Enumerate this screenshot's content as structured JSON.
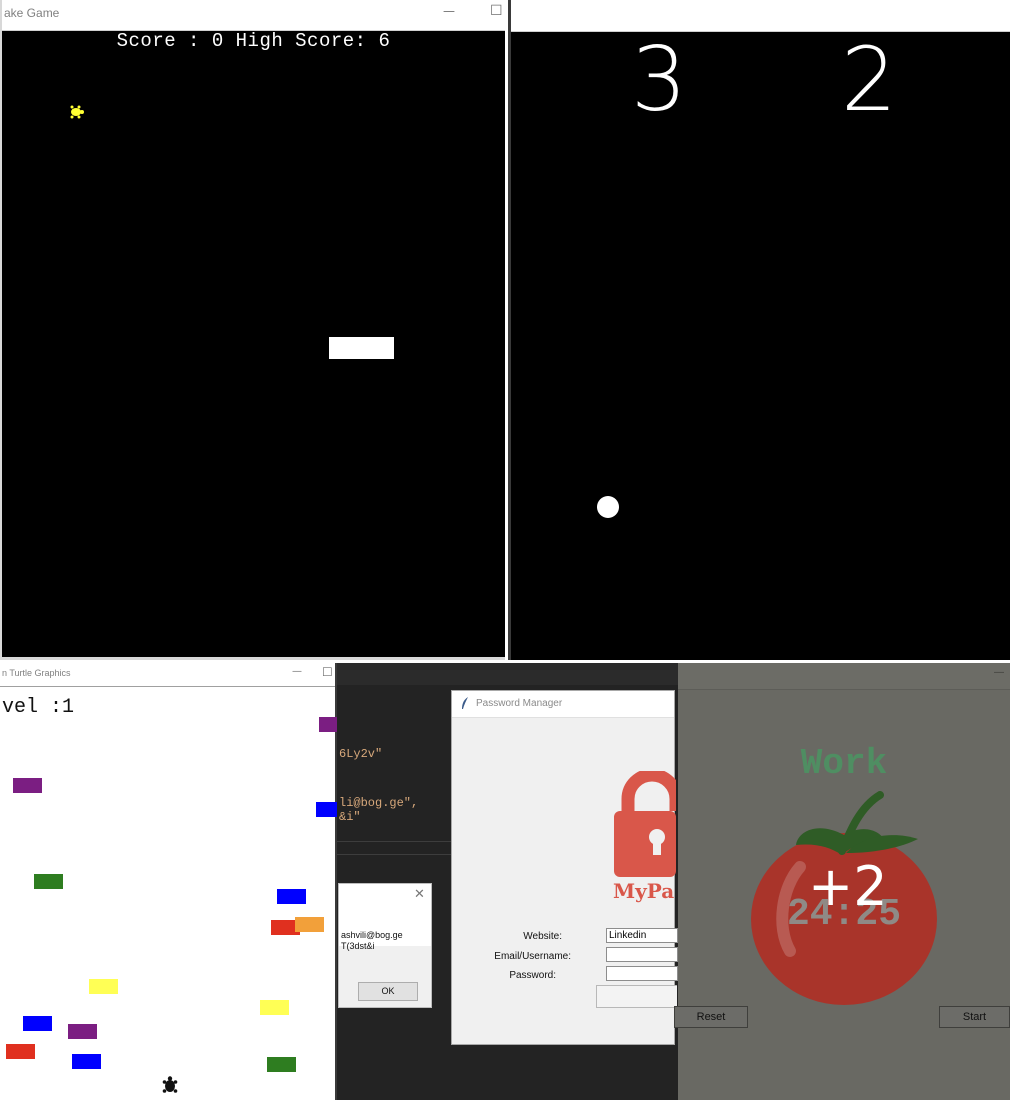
{
  "snake_window": {
    "title": "ake Game",
    "minimize_glyph": "—",
    "maximize_glyph": "☐",
    "score_text": "Score : 0 High Score: 6",
    "food_color": "#ffff33",
    "paddle_color": "#ffffff"
  },
  "pong_window": {
    "score_left": "3",
    "score_right": "2",
    "ball_color": "#ffffff"
  },
  "turtle_window": {
    "title": "n Turtle Graphics",
    "minimize_glyph": "—",
    "maximize_glyph": "☐",
    "level_text": "vel :1",
    "brick_colors": [
      "#7b1e82",
      "#7b1e82",
      "#0000ff",
      "#2e7d20",
      "#0000ff",
      "#e0301f",
      "#f2a03a",
      "#ffff55",
      "#ffff55",
      "#0000ff",
      "#7b1e82",
      "#e0301f",
      "#0000ff",
      "#2e7d20"
    ],
    "player_icon": "turtle-icon"
  },
  "code_editor": {
    "lines": [
      "6Ly2v\"",
      "li@bog.ge\",",
      "&i\""
    ]
  },
  "confirm_dialog": {
    "close_glyph": "✕",
    "message_line1": "ashvili@bog.ge",
    "message_line2": "T(3dst&i",
    "ok_label": "OK"
  },
  "password_manager": {
    "title": "Password Manager",
    "logo_text": "MyPa",
    "lock_color": "#d9574a",
    "website_label": "Website:",
    "website_value": "Linkedin",
    "email_label": "Email/Username:",
    "email_value": "",
    "password_label": "Password:",
    "password_value": ""
  },
  "pomodoro": {
    "heading": "Work",
    "timer": "24:25",
    "reset_label": "Reset",
    "start_label": "Start",
    "overlay_count": "+2",
    "heading_color": "#4f8e62",
    "tomato_color": "#a9342a"
  }
}
